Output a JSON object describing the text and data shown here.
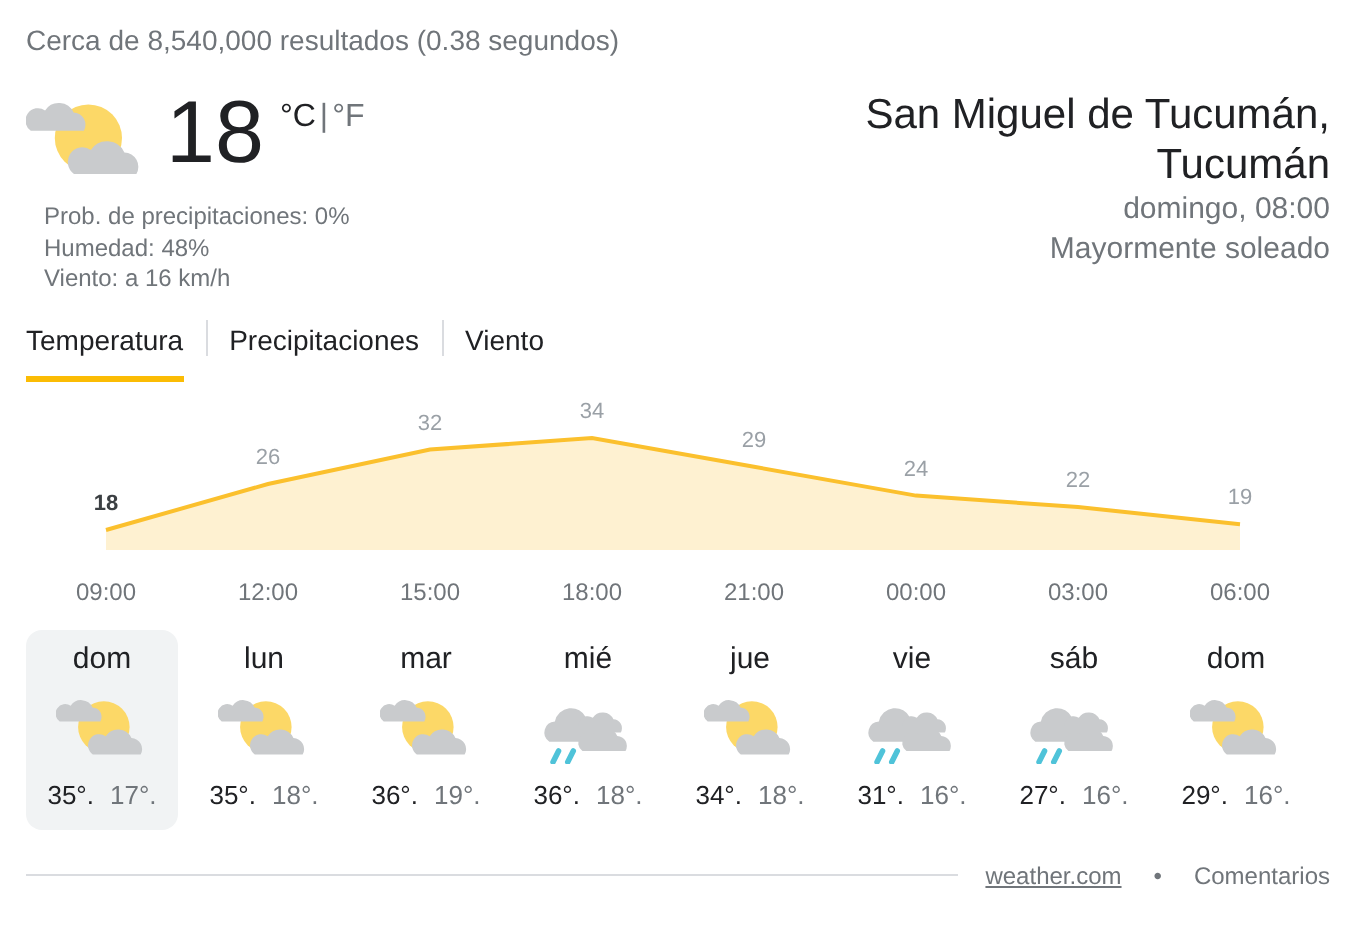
{
  "result_stats": "Cerca de 8,540,000 resultados (0.38 segundos)",
  "current": {
    "kind": "partly_cloudy",
    "temperature": "18",
    "unit_c": "°C",
    "unit_separator": "|",
    "unit_f": "°F",
    "unit_c_selected": true,
    "details": [
      "Prob. de precipitaciones: 0%",
      "Humedad: 48%",
      "Viento: a 16 km/h"
    ]
  },
  "location": {
    "place": "San Miguel de Tucumán, Tucumán",
    "time": "domingo, 08:00",
    "condition": "Mayormente soleado"
  },
  "tabs": [
    {
      "label": "Temperatura",
      "selected": true
    },
    {
      "label": "Precipitaciones",
      "selected": false
    },
    {
      "label": "Viento",
      "selected": false
    }
  ],
  "chart_data": {
    "type": "area",
    "categories": [
      "09:00",
      "12:00",
      "15:00",
      "18:00",
      "21:00",
      "00:00",
      "03:00",
      "06:00"
    ],
    "series": [
      {
        "color": "#fbc02d",
        "values": [
          18,
          26,
          32,
          34,
          29,
          24,
          22,
          19
        ]
      }
    ],
    "data_labels": true
  },
  "forecast": [
    {
      "day": "dom",
      "kind": "partly_cloudy",
      "high": "35°.",
      "low": "17°.",
      "selected": true
    },
    {
      "day": "lun",
      "kind": "partly_cloudy",
      "high": "35°.",
      "low": "18°.",
      "selected": false
    },
    {
      "day": "mar",
      "kind": "partly_cloudy",
      "high": "36°.",
      "low": "19°.",
      "selected": false
    },
    {
      "day": "mié",
      "kind": "rain",
      "high": "36°.",
      "low": "18°.",
      "selected": false
    },
    {
      "day": "jue",
      "kind": "partly_cloudy",
      "high": "34°.",
      "low": "18°.",
      "selected": false
    },
    {
      "day": "vie",
      "kind": "rain",
      "high": "31°.",
      "low": "16°.",
      "selected": false
    },
    {
      "day": "sáb",
      "kind": "rain",
      "high": "27°.",
      "low": "16°.",
      "selected": false
    },
    {
      "day": "dom",
      "kind": "partly_cloudy",
      "high": "29°.",
      "low": "16°.",
      "selected": false
    }
  ],
  "footer": {
    "source": "weather.com",
    "separator": "•",
    "feedback": "Comentarios"
  }
}
